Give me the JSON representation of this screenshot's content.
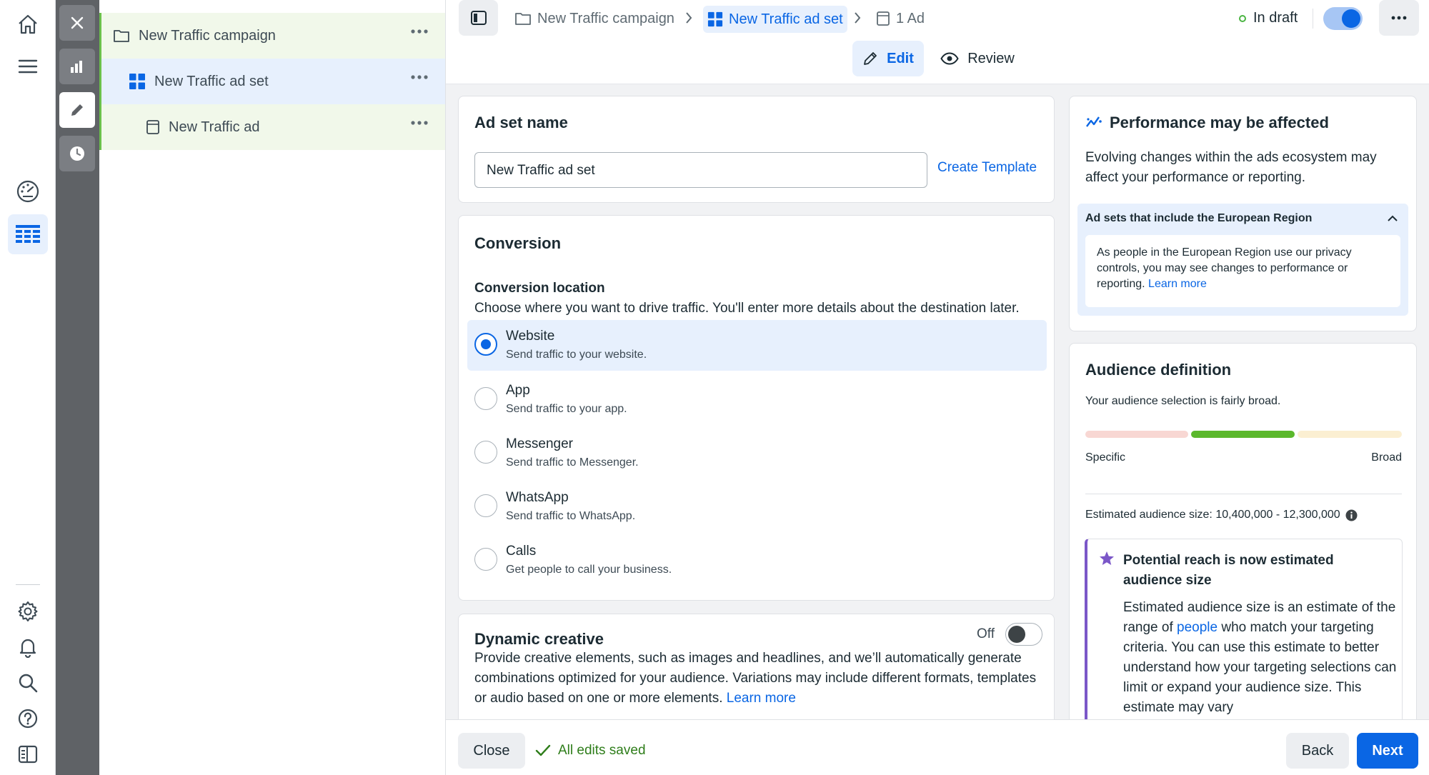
{
  "tree": {
    "campaign": "New Traffic campaign",
    "adset": "New Traffic ad set",
    "ad": "New Traffic ad"
  },
  "breadcrumb": {
    "campaign": "New Traffic campaign",
    "adset": "New Traffic ad set",
    "ad": "1 Ad"
  },
  "status": {
    "label": "In draft",
    "toggle_on": true
  },
  "tabs": {
    "edit": "Edit",
    "review": "Review"
  },
  "adset_name": {
    "heading": "Ad set name",
    "value": "New Traffic ad set",
    "template_link": "Create Template"
  },
  "conversion": {
    "heading": "Conversion",
    "location_label": "Conversion location",
    "location_desc": "Choose where you want to drive traffic. You'll enter more details about the destination later.",
    "options": [
      {
        "title": "Website",
        "sub": "Send traffic to your website.",
        "selected": true
      },
      {
        "title": "App",
        "sub": "Send traffic to your app.",
        "selected": false
      },
      {
        "title": "Messenger",
        "sub": "Send traffic to Messenger.",
        "selected": false
      },
      {
        "title": "WhatsApp",
        "sub": "Send traffic to WhatsApp.",
        "selected": false
      },
      {
        "title": "Calls",
        "sub": "Get people to call your business.",
        "selected": false
      }
    ]
  },
  "dynamic_creative": {
    "heading": "Dynamic creative",
    "state": "Off",
    "desc": "Provide creative elements, such as images and headlines, and we’ll automatically generate combinations optimized for your audience. Variations may include different formats, templates or audio based on one or more elements.",
    "link": "Learn more"
  },
  "performance": {
    "heading": "Performance may be affected",
    "desc": "Evolving changes within the ads ecosystem may affect your performance or reporting.",
    "region_heading": "Ad sets that include the European Region",
    "region_text": "As people in the European Region use our privacy controls, you may see changes to performance or reporting.",
    "region_link": "Learn more"
  },
  "audience": {
    "heading": "Audience definition",
    "summary": "Your audience selection is fairly broad.",
    "specific": "Specific",
    "broad": "Broad",
    "size_label": "Estimated audience size: 10,400,000 - 12,300,000",
    "reach_heading": "Potential reach is now estimated audience size",
    "reach_text_before": "Estimated audience size is an estimate of the range of",
    "reach_link": "people",
    "reach_text_after": "who match your targeting criteria. You can use this estimate to better understand how your targeting selections can limit or expand your audience size. This estimate may vary"
  },
  "footer": {
    "close": "Close",
    "saved": "All edits saved",
    "back": "Back",
    "next": "Next"
  },
  "colors": {
    "accent": "#0a66e4",
    "draft_dot": "#4bb543",
    "meter_specific": "#f8d7d3",
    "meter_mid": "#5bb82c",
    "meter_broad": "#fbefd2",
    "reach_border": "#7b57c8"
  }
}
